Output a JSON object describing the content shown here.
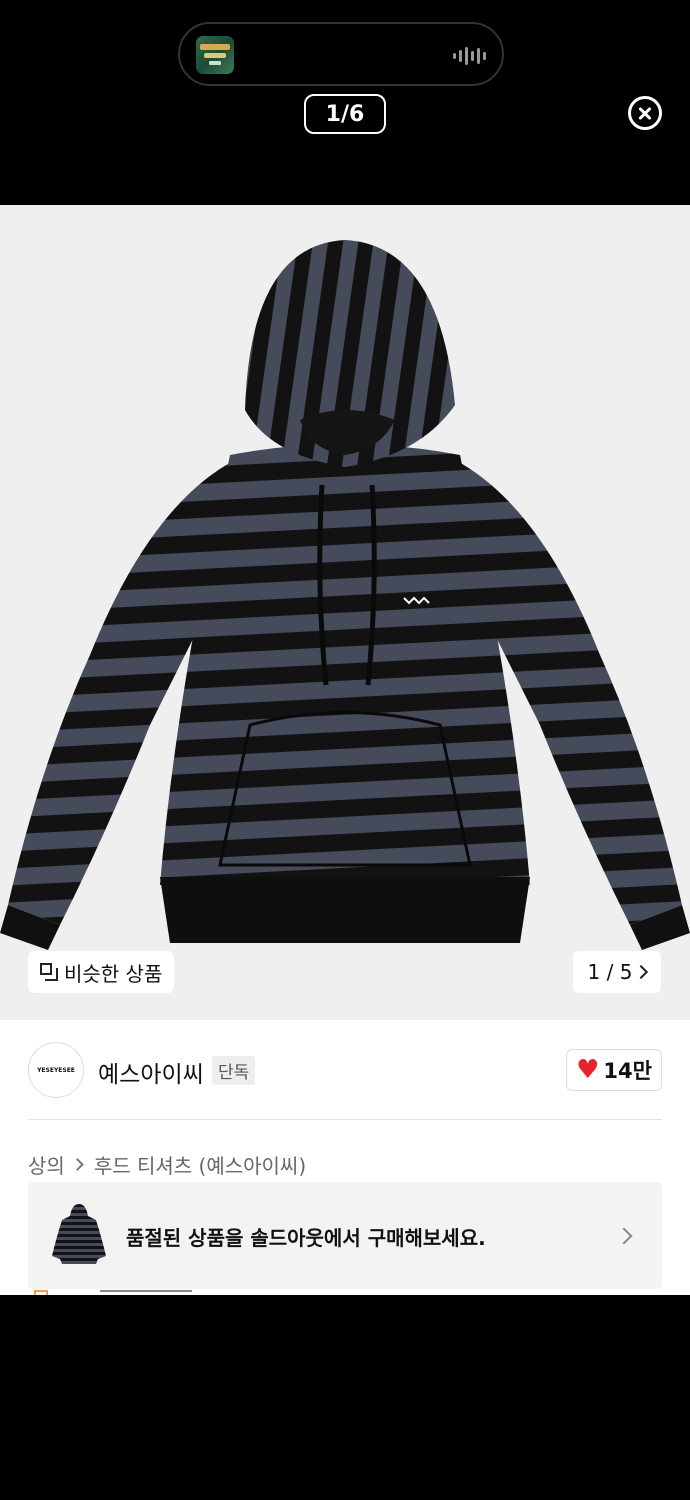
{
  "status_bar": {
    "now_playing_icon": "album-art-thumbnail",
    "waveform_icon": "audio-waveform-icon"
  },
  "viewer": {
    "counter": "1/6",
    "close_icon": "close-circle-icon"
  },
  "product": {
    "similar_button_label": "비슷한 상품",
    "image_pager": "1 / 5",
    "brand_logo_text": "YESEYESEE",
    "brand_name": "예스아이씨",
    "exclusive_badge": "단독",
    "like_count": "14만",
    "breadcrumb": [
      "상의",
      "후드 티셔츠 (예스아이씨)"
    ],
    "soldout_banner": "품절된 상품을 솔드아웃에서 구매해보세요."
  },
  "colors": {
    "stripe_dark": "#111111",
    "stripe_grey": "#464b5c",
    "heart": "#e8222c"
  }
}
